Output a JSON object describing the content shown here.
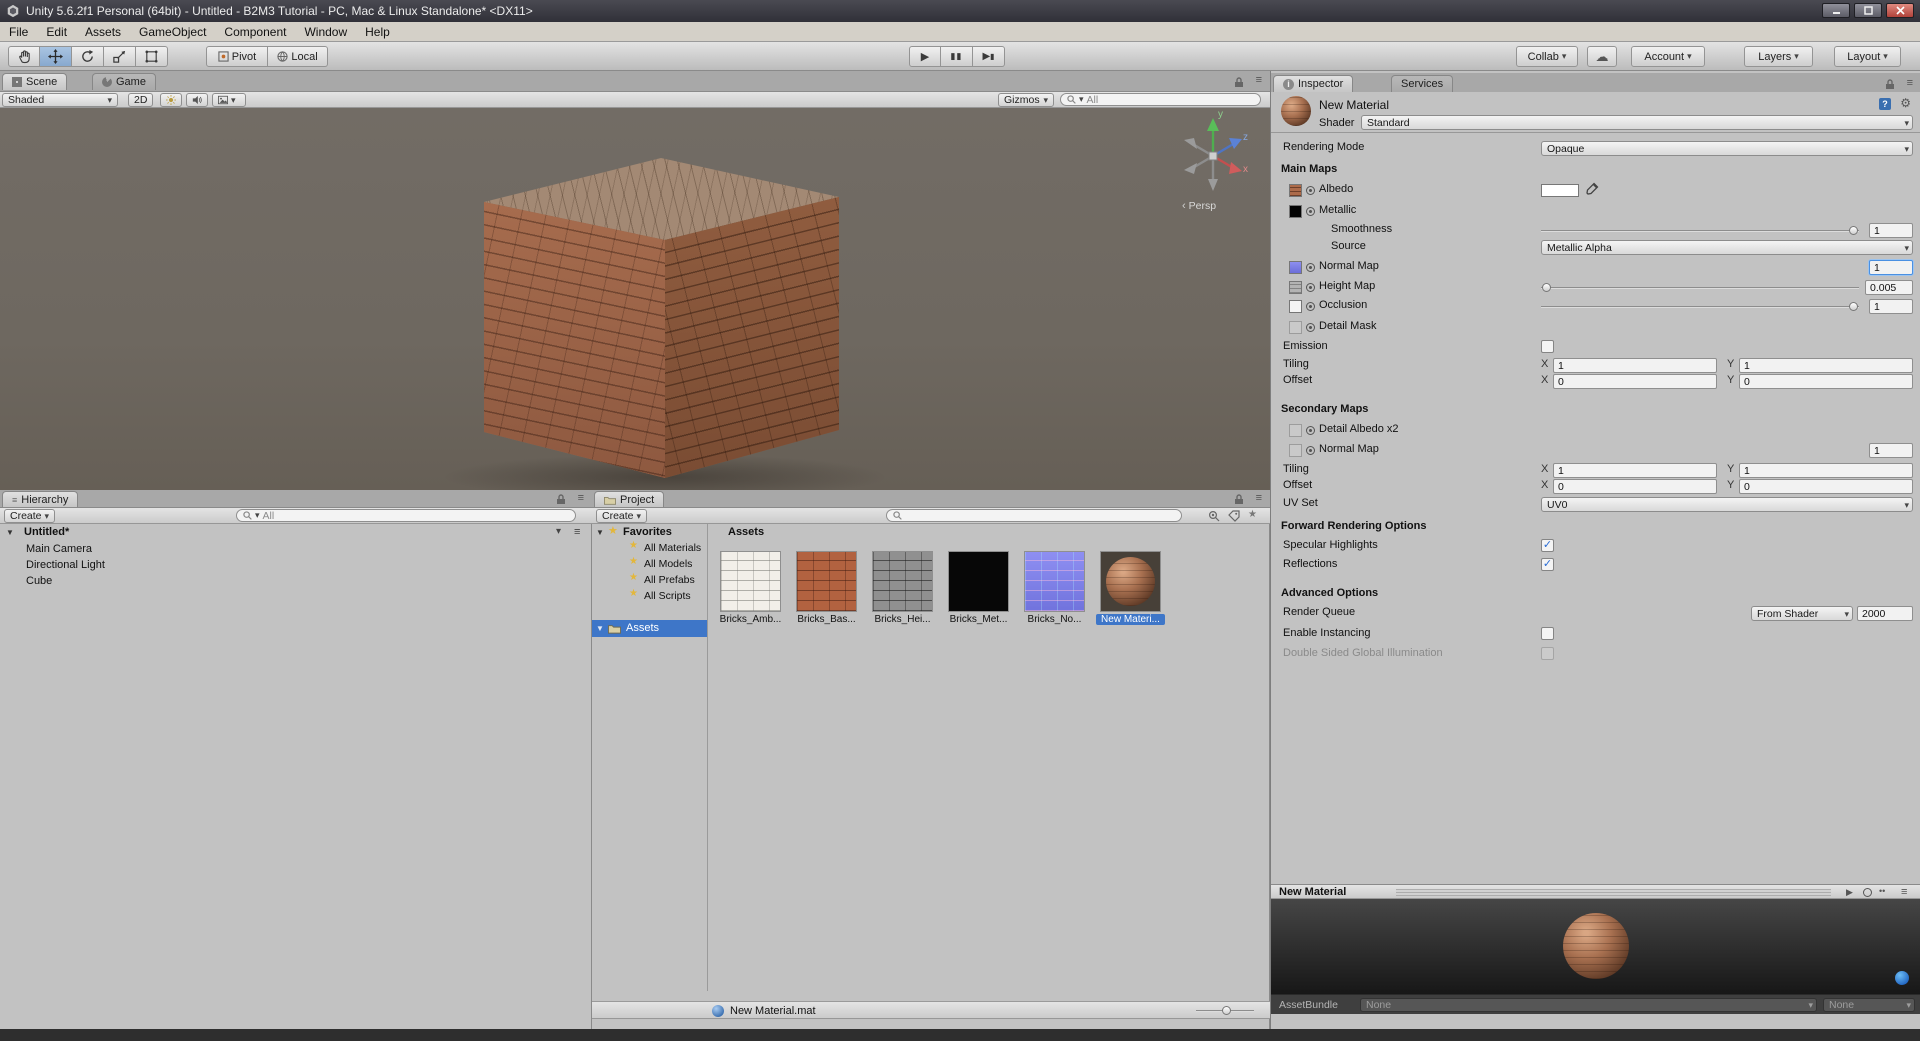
{
  "icons": {
    "dropdown": "▾",
    "collapse": "▼",
    "menu": "≡",
    "check": "✓",
    "play": "▶",
    "pause_bar": "▮",
    "cloud": "☁",
    "star": "★",
    "gear": "⚙",
    "info": "i",
    "help": "?",
    "dots": "••",
    "chevron_left": "‹"
  },
  "window": {
    "title": "Unity 5.6.2f1 Personal (64bit) - Untitled - B2M3 Tutorial - PC, Mac & Linux Standalone* <DX11>"
  },
  "menu": {
    "items": [
      "File",
      "Edit",
      "Assets",
      "GameObject",
      "Component",
      "Window",
      "Help"
    ]
  },
  "toolbar": {
    "pivot_label": "Pivot",
    "local_label": "Local",
    "collab_label": "Collab",
    "account_label": "Account",
    "layers_label": "Layers",
    "layout_label": "Layout"
  },
  "scene": {
    "tab_scene": "Scene",
    "tab_game": "Game",
    "shaded_label": "Shaded",
    "mode_2d": "2D",
    "gizmos_label": "Gizmos",
    "search_text": "All",
    "persp_label": "Persp",
    "axis_x": "x",
    "axis_y": "y",
    "axis_z": "z"
  },
  "hierarchy": {
    "tab": "Hierarchy",
    "create_label": "Create",
    "search_text": "All",
    "scene_name": "Untitled*",
    "items": [
      "Main Camera",
      "Directional Light",
      "Cube"
    ]
  },
  "project": {
    "tab": "Project",
    "create_label": "Create",
    "favorites_label": "Favorites",
    "favorites": [
      "All Materials",
      "All Models",
      "All Prefabs",
      "All Scripts"
    ],
    "assets_folder_label": "Assets",
    "assets_header": "Assets",
    "assets": [
      {
        "label": "Bricks_Amb..."
      },
      {
        "label": "Bricks_Bas..."
      },
      {
        "label": "Bricks_Hei..."
      },
      {
        "label": "Bricks_Met..."
      },
      {
        "label": "Bricks_No..."
      },
      {
        "label": "New Materi..."
      }
    ],
    "selected_file": "New Material.mat"
  },
  "inspector": {
    "tab_inspector": "Inspector",
    "tab_services": "Services",
    "material_name": "New Material",
    "shader_label": "Shader",
    "shader_value": "Standard",
    "rendering_mode_label": "Rendering Mode",
    "rendering_mode_value": "Opaque",
    "main_maps_header": "Main Maps",
    "albedo_label": "Albedo",
    "metallic_label": "Metallic",
    "smoothness_label": "Smoothness",
    "smoothness_value": "1",
    "source_label": "Source",
    "source_value": "Metallic Alpha",
    "normal_map_label": "Normal Map",
    "normal_map_value": "1",
    "height_map_label": "Height Map",
    "height_map_value": "0.005",
    "occlusion_label": "Occlusion",
    "occlusion_value": "1",
    "detail_mask_label": "Detail Mask",
    "emission_label": "Emission",
    "x_label": "X",
    "y_label": "Y",
    "tiling_label": "Tiling",
    "tiling_x": "1",
    "tiling_y": "1",
    "offset_label": "Offset",
    "offset_x": "0",
    "offset_y": "0",
    "secondary_maps_header": "Secondary Maps",
    "detail_albedo_label": "Detail Albedo x2",
    "normal_map2_label": "Normal Map",
    "normal_map2_value": "1",
    "tiling2_label": "Tiling",
    "tiling2_x": "1",
    "tiling2_y": "1",
    "offset2_label": "Offset",
    "offset2_x": "0",
    "offset2_y": "0",
    "uv_set_label": "UV Set",
    "uv_set_value": "UV0",
    "forward_header": "Forward Rendering Options",
    "specular_label": "Specular Highlights",
    "reflections_label": "Reflections",
    "advanced_header": "Advanced Options",
    "render_queue_label": "Render Queue",
    "render_queue_value": "From Shader",
    "render_queue_number": "2000",
    "enable_instancing_label": "Enable Instancing",
    "double_sided_gi_label": "Double Sided Global Illumination"
  },
  "preview": {
    "title": "New Material",
    "assetbundle_label": "AssetBundle",
    "assetbundle_value": "None",
    "assetbundle_variant_value": "None"
  },
  "colors": {
    "selection_blue": "#3e76c8",
    "scene_background": "#6e6860",
    "brick_base": "#a2684a"
  }
}
